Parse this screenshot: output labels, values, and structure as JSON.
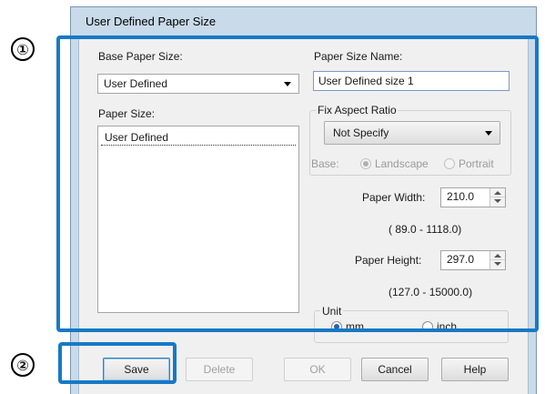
{
  "callouts": {
    "step1": "①",
    "step2": "②"
  },
  "window": {
    "title": "User Defined Paper Size"
  },
  "base_paper_size": {
    "label": "Base Paper Size:",
    "value": "User Defined"
  },
  "paper_size": {
    "label": "Paper Size:",
    "items": [
      "User Defined"
    ]
  },
  "paper_size_name": {
    "label": "Paper Size Name:",
    "value": "User Defined size 1"
  },
  "fix_aspect_ratio": {
    "label": "Fix Aspect Ratio",
    "value": "Not Specify",
    "base_label": "Base:",
    "landscape_label": "Landscape",
    "portrait_label": "Portrait",
    "selected": "Landscape"
  },
  "paper_width": {
    "label": "Paper Width:",
    "value": "210.0",
    "range": "( 89.0 - 1118.0)"
  },
  "paper_height": {
    "label": "Paper Height:",
    "value": "297.0",
    "range": "(127.0 - 15000.0)"
  },
  "unit": {
    "label": "Unit",
    "mm_label": "mm",
    "inch_label": "inch",
    "selected": "mm"
  },
  "buttons": {
    "save": "Save",
    "delete": "Delete",
    "ok": "OK",
    "cancel": "Cancel",
    "help": "Help"
  },
  "colors": {
    "highlight": "#1779c6",
    "titlebar": "#c9daea"
  }
}
